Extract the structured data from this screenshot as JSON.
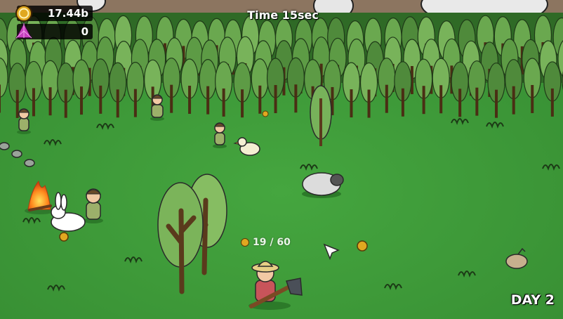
{
  "hud": {
    "coins": "17.44b",
    "gems": "0",
    "timer": "Time 15sec",
    "day": "DAY 2"
  },
  "carry": {
    "label": "19 / 60",
    "current": 19,
    "capacity": 60
  },
  "colors": {
    "grass": "#3e9a3a",
    "forest": "#2f6a26",
    "coin": "#e0a820",
    "gem": "#c63fbd"
  },
  "icons": [
    "coin-icon",
    "gem-icon",
    "campfire-icon",
    "axe-icon",
    "pointer-icon",
    "sack-icon"
  ]
}
